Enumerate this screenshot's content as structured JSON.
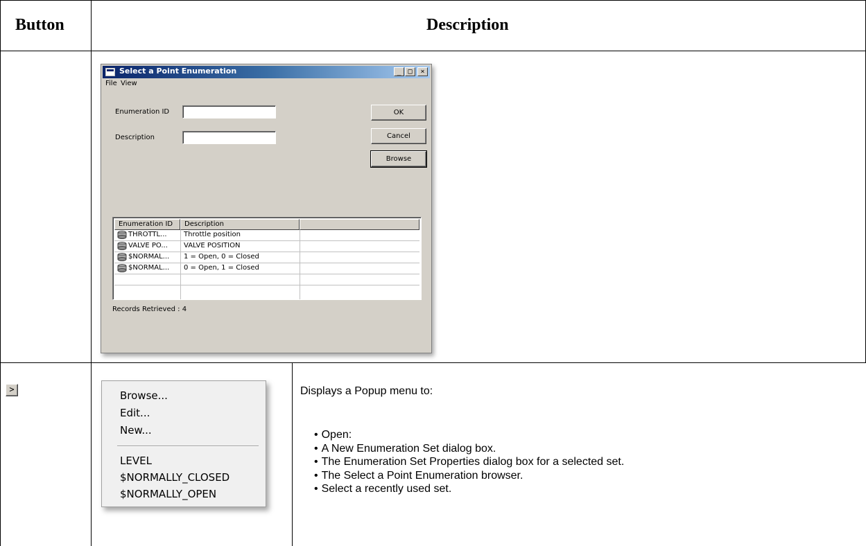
{
  "table": {
    "headers": {
      "button": "Button",
      "description": "Description"
    }
  },
  "dialog": {
    "title": "Select a Point Enumeration",
    "title_buttons": {
      "minimize": "_",
      "maximize": "□",
      "close": "×"
    },
    "menu": [
      "File",
      "View"
    ],
    "fields": {
      "enumeration_id_label": "Enumeration ID",
      "enumeration_id_value": "",
      "description_label": "Description",
      "description_value": ""
    },
    "buttons": {
      "ok": "OK",
      "cancel": "Cancel",
      "browse": "Browse"
    },
    "grid": {
      "columns": [
        "Enumeration ID",
        "Description",
        ""
      ],
      "rows": [
        {
          "id": "THROTTL...",
          "description": "Throttle position"
        },
        {
          "id": "VALVE PO...",
          "description": "VALVE POSITION"
        },
        {
          "id": "$NORMAL...",
          "description": "1 = Open, 0 = Closed"
        },
        {
          "id": "$NORMAL...",
          "description": "0 = Open, 1 = Closed"
        }
      ]
    },
    "status": "Records Retrieved : 4"
  },
  "row2": {
    "button_glyph": ">",
    "popup_menu": {
      "items": [
        "Browse...",
        "Edit...",
        "New..."
      ],
      "recent": [
        "LEVEL",
        "$NORMALLY_CLOSED",
        "$NORMALLY_OPEN"
      ]
    },
    "description_intro": "Displays a Popup menu to:",
    "bullets": [
      "Open:",
      "A New Enumeration Set dialog box.",
      "The Enumeration Set Properties dialog box for a selected set.",
      "The Select a Point Enumeration browser.",
      "Select a recently used set."
    ]
  }
}
